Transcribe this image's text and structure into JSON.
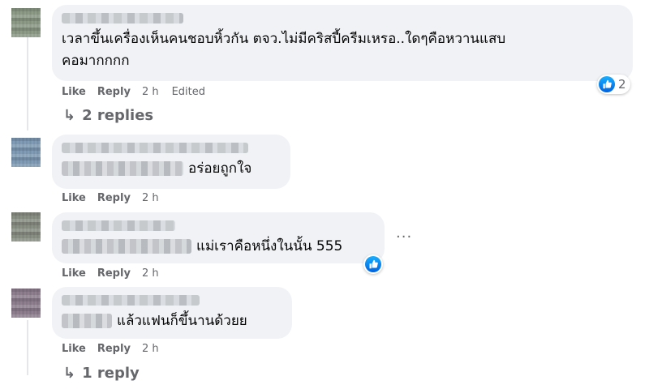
{
  "comments": [
    {
      "text_line1": "เวลาขึ้นเครื่องเห็นคนชอบหิ้วกัน ตจว.ไม่มีคริสปี้ครีมเหรอ..ใดๆคือหวานแสบ",
      "text_line2": "คอมากกกก",
      "like": "Like",
      "reply": "Reply",
      "time": "2 h",
      "edited": "Edited",
      "reaction_count": "2",
      "replies_label": "2 replies",
      "avatar_color": "#8c9a86"
    },
    {
      "text": "อร่อยถูกใจ",
      "like": "Like",
      "reply": "Reply",
      "time": "2 h",
      "avatar_color": "#7f9bb5"
    },
    {
      "text": "แม่เราคือหนึ่งในนั้น 555",
      "like": "Like",
      "reply": "Reply",
      "time": "2 h",
      "more": "···",
      "avatar_color": "#8a8f84"
    },
    {
      "text": "แล้วแฟนก็ขึ้นานด้วยย",
      "like": "Like",
      "reply": "Reply",
      "time": "2 h",
      "replies_label": "1 reply",
      "avatar_color": "#8e7e8e"
    }
  ],
  "icons": {
    "reply_arrow": "↳",
    "thumbs_up": "thumbs-up-icon"
  },
  "colors": {
    "bubble": "#f0f2f5",
    "meta": "#65676b",
    "like_blue": "#0571ed"
  }
}
